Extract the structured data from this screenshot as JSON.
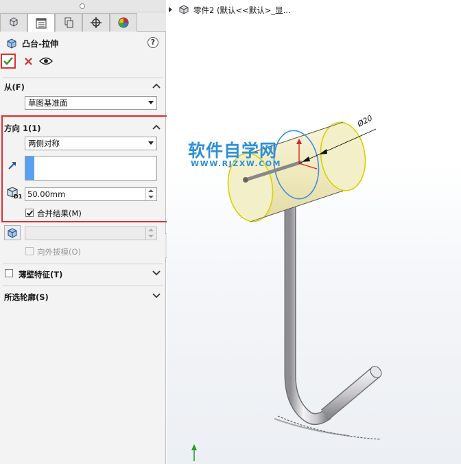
{
  "feature": {
    "title": "凸台-拉伸",
    "help": "?"
  },
  "from_section": {
    "header": "从(F)",
    "start_condition": "草图基准面"
  },
  "direction1_section": {
    "header": "方向 1(1)",
    "end_condition": "两侧对称",
    "depth_value": "50.00mm",
    "depth_icon_label": "D1",
    "merge_label": "合并结果(M)",
    "merge_checked": true
  },
  "draft": {
    "label": "向外拔模(O)",
    "checked": false
  },
  "thin_feature": {
    "label": "薄壁特征(T)",
    "checked": false
  },
  "selected_contours": {
    "label": "所选轮廓(S)"
  },
  "tree": {
    "label": "零件2 (默认<<默认>_显..."
  },
  "watermark": {
    "name": "软件自学网",
    "url": "WWW.RJZXW.COM"
  },
  "dimension": {
    "label": "Ø20"
  },
  "colors": {
    "accent_red": "#e03030",
    "selection_blue": "#5aa0f0",
    "cylinder_yellow": "#f4f0c8",
    "watermark_blue": "#2f8fd8"
  }
}
